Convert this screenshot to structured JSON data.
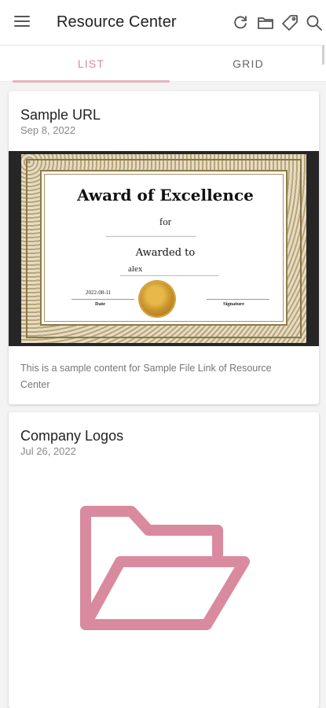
{
  "app": {
    "title": "Resource Center"
  },
  "toolbar": {
    "menu_icon": "menu-icon",
    "refresh_icon": "refresh-icon",
    "folder_icon": "folder-icon",
    "tag_icon": "tag-icon",
    "search_icon": "search-icon"
  },
  "tabs": [
    {
      "label": "LIST",
      "active": true
    },
    {
      "label": "GRID",
      "active": false
    }
  ],
  "colors": {
    "accent": "#d98a9e",
    "folder_illustration": "#d98a9e"
  },
  "cards": [
    {
      "title": "Sample URL",
      "date": "Sep 8, 2022",
      "description": "This is a sample content for Sample File Link of Resource Center",
      "certificate": {
        "heading": "Award of Excellence",
        "for": "for",
        "awarded_to": "Awarded to",
        "name": "alex",
        "date_value": "2022-08-11",
        "date_label": "Date",
        "signature_label": "Signature"
      }
    },
    {
      "title": "Company Logos",
      "date": "Jul 26, 2022",
      "illustration": "open-folder-icon"
    }
  ]
}
